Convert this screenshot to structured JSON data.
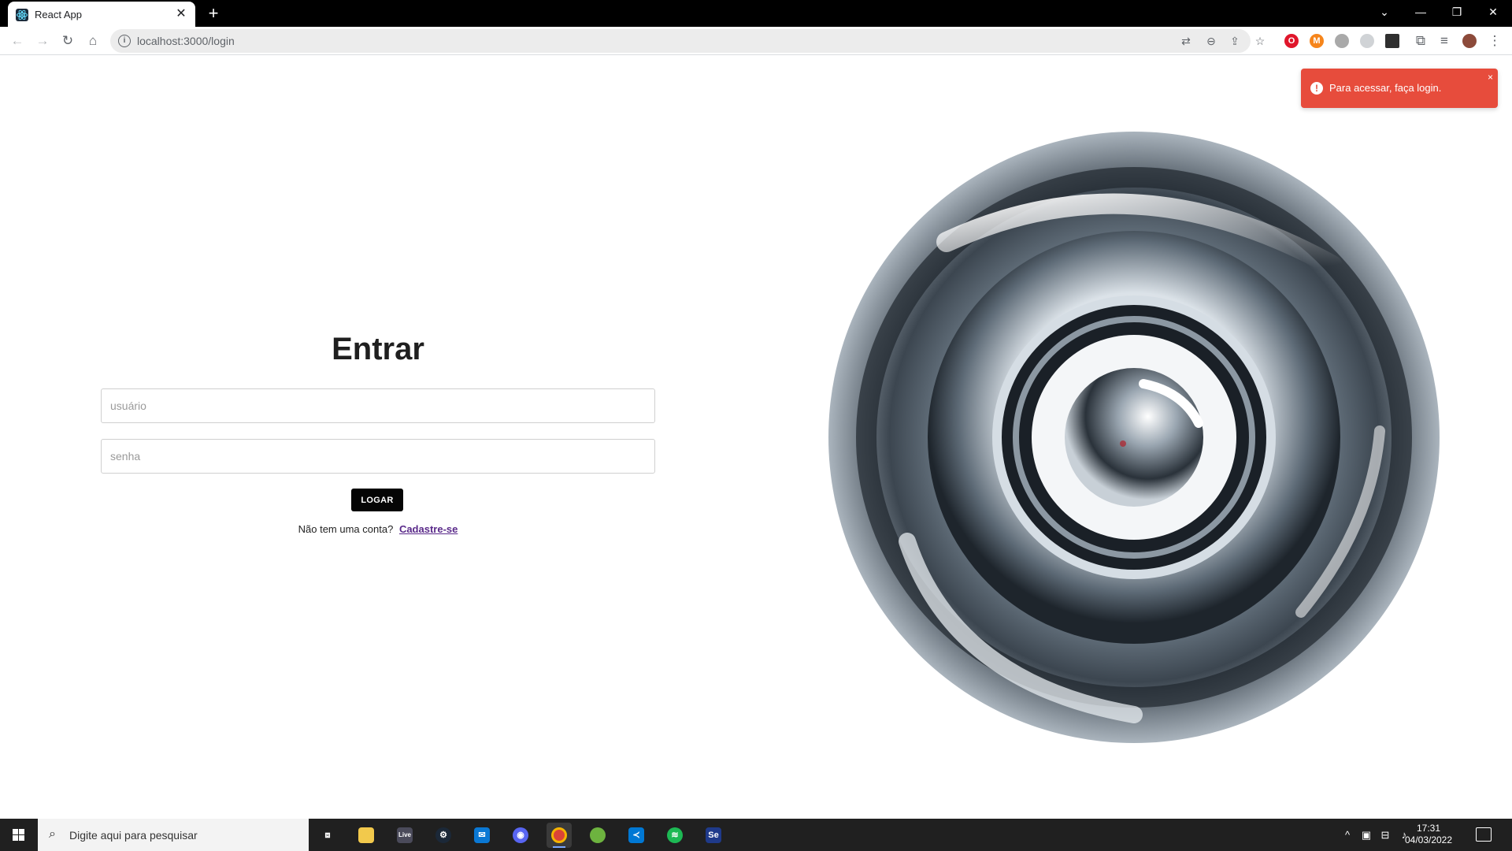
{
  "browser": {
    "tab_title": "React App",
    "url": "localhost:3000/login",
    "new_tab_label": "+",
    "close_tab_label": "✕"
  },
  "login": {
    "title": "Entrar",
    "username_placeholder": "usuário",
    "password_placeholder": "senha",
    "submit_label": "LOGAR",
    "no_account_text": "Não tem uma conta?",
    "signup_link": "Cadastre-se"
  },
  "toast": {
    "message": "Para acessar, faça login.",
    "close_label": "×",
    "color": "#e74c3c"
  },
  "taskbar": {
    "search_placeholder": "Digite aqui para pesquisar",
    "time": "17:31",
    "date": "04/03/2022",
    "apps": [
      "task-view",
      "file-explorer",
      "live",
      "steam",
      "mail",
      "discord",
      "chrome",
      "spring",
      "vscode",
      "spotify",
      "selenium"
    ]
  },
  "icons": {
    "back": "arrow-left-icon",
    "forward": "arrow-right-icon",
    "reload": "reload-icon",
    "home": "home-icon",
    "info": "info-icon",
    "translate": "translate-icon",
    "zoom": "zoom-icon",
    "share": "share-icon",
    "bookmark": "star-icon",
    "extensions": "puzzle-icon",
    "menu": "kebab-menu-icon"
  }
}
